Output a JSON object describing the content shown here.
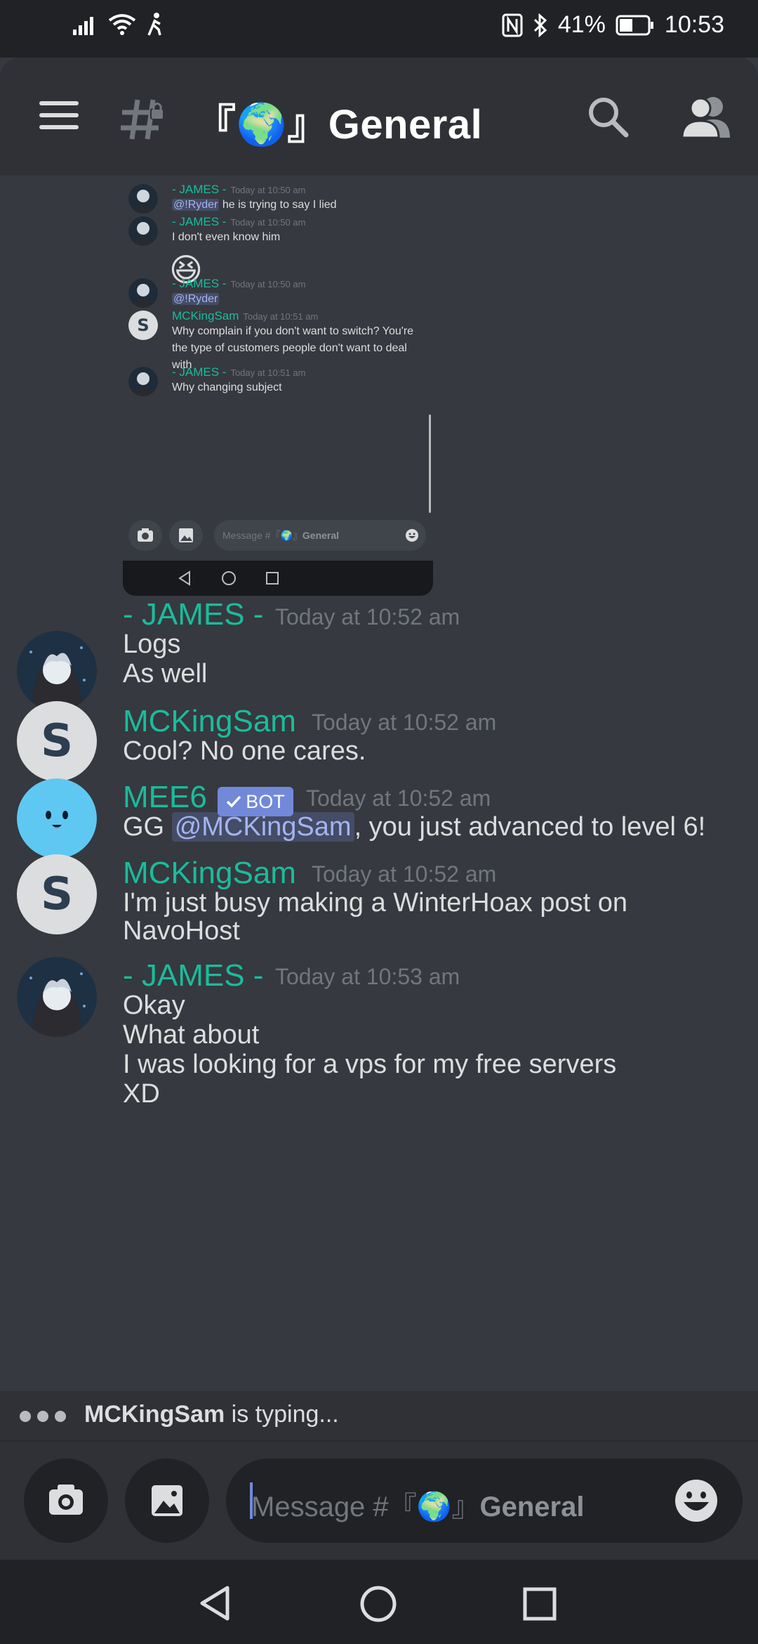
{
  "status_bar": {
    "battery": "41%",
    "time": "10:53"
  },
  "header": {
    "channel_title": "『🌍』General"
  },
  "embedded_screenshot": {
    "messages": [
      {
        "author": "- JAMES -",
        "time": "Today at 10:50 am",
        "mention": "@!Ryder",
        "text": " he is trying to say I lied"
      },
      {
        "author": "- JAMES -",
        "time": "Today at 10:50 am",
        "text": "I don't even know him",
        "emoji": "😆"
      },
      {
        "author": "- JAMES -",
        "time": "Today at 10:50 am",
        "mention": "@!Ryder"
      },
      {
        "author": "MCKingSam",
        "time": "Today at 10:51 am",
        "lines": [
          "Why complain if you don't want to switch? You're",
          "the type of customers people don't want to deal",
          "with"
        ]
      },
      {
        "author": "- JAMES -",
        "time": "Today at 10:51 am",
        "text": "Why changing subject"
      }
    ],
    "input_placeholder_prefix": "Message #『🌍』",
    "input_placeholder_channel": "General"
  },
  "messages": [
    {
      "author": "- JAMES -",
      "time": "Today at 10:52 am",
      "lines": [
        "Logs",
        "As well"
      ]
    },
    {
      "author": "MCKingSam",
      "time": "Today at 10:52 am",
      "lines": [
        "Cool? No one cares."
      ]
    },
    {
      "author": "MEE6",
      "badge": "BOT",
      "time": "Today at 10:52 am",
      "prefix": "GG ",
      "mention": "@MCKingSam",
      "suffix": ", you just advanced to level 6!"
    },
    {
      "author": "MCKingSam",
      "time": "Today at 10:52 am",
      "lines": [
        "I'm just busy making a WinterHoax post on",
        "NavoHost"
      ]
    },
    {
      "author": "- JAMES -",
      "time": "Today at 10:53 am",
      "lines": [
        "Okay",
        "What about",
        "I was looking for a vps for my free servers",
        "XD"
      ]
    }
  ],
  "typing_indicator": {
    "user": "MCKingSam",
    "text": " is typing..."
  },
  "composer": {
    "placeholder_prefix": "Message #『🌍』",
    "placeholder_channel": "General"
  },
  "colors": {
    "background": "#36393f",
    "header": "#2f3136",
    "username_teal": "#1abc9c",
    "blurple": "#7289da",
    "timestamp": "#72767d"
  },
  "icons": {
    "menu": "hamburger-icon",
    "channel": "locked-hash-icon",
    "search": "search-icon",
    "members": "members-icon",
    "camera": "camera-icon",
    "gallery": "image-icon",
    "emoji": "emoji-icon"
  }
}
